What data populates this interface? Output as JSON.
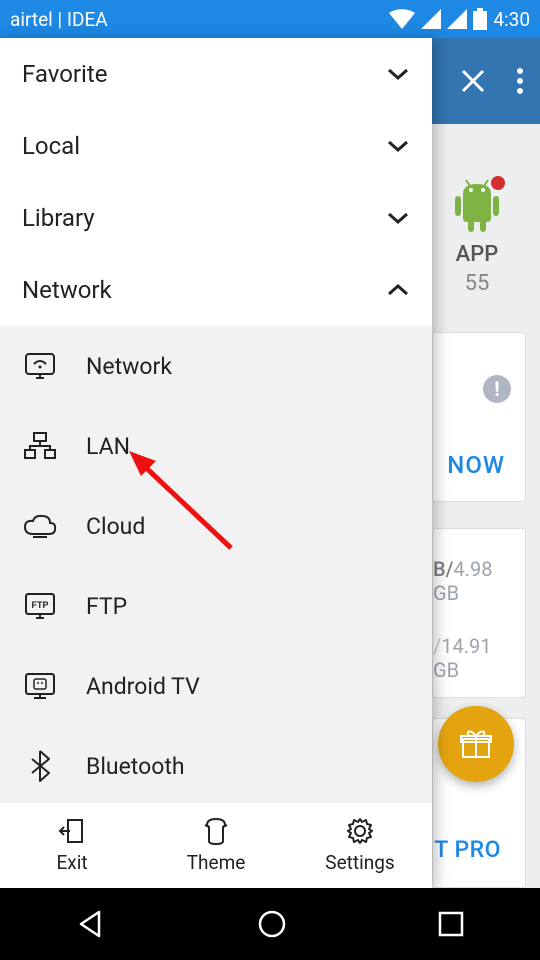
{
  "status": {
    "carrier": "airtel | IDEA",
    "time": "4:30"
  },
  "drawer": {
    "groups": [
      {
        "label": "Favorite",
        "expanded": false
      },
      {
        "label": "Local",
        "expanded": false
      },
      {
        "label": "Library",
        "expanded": false
      },
      {
        "label": "Network",
        "expanded": true
      }
    ],
    "network_items": [
      {
        "label": "Network"
      },
      {
        "label": "LAN"
      },
      {
        "label": "Cloud"
      },
      {
        "label": "FTP"
      },
      {
        "label": "Android TV"
      },
      {
        "label": "Bluetooth"
      }
    ],
    "bottom": {
      "exit": "Exit",
      "theme": "Theme",
      "settings": "Settings"
    }
  },
  "app": {
    "tile": {
      "label": "APP",
      "count": "55"
    },
    "card1": {
      "cta": "NOW"
    },
    "card2": {
      "line1a": "B/",
      "line1b": "4.98 GB",
      "line2": "14.91 GB"
    },
    "card3": {
      "pro": "T PRO"
    }
  },
  "arrow_target": "lan"
}
